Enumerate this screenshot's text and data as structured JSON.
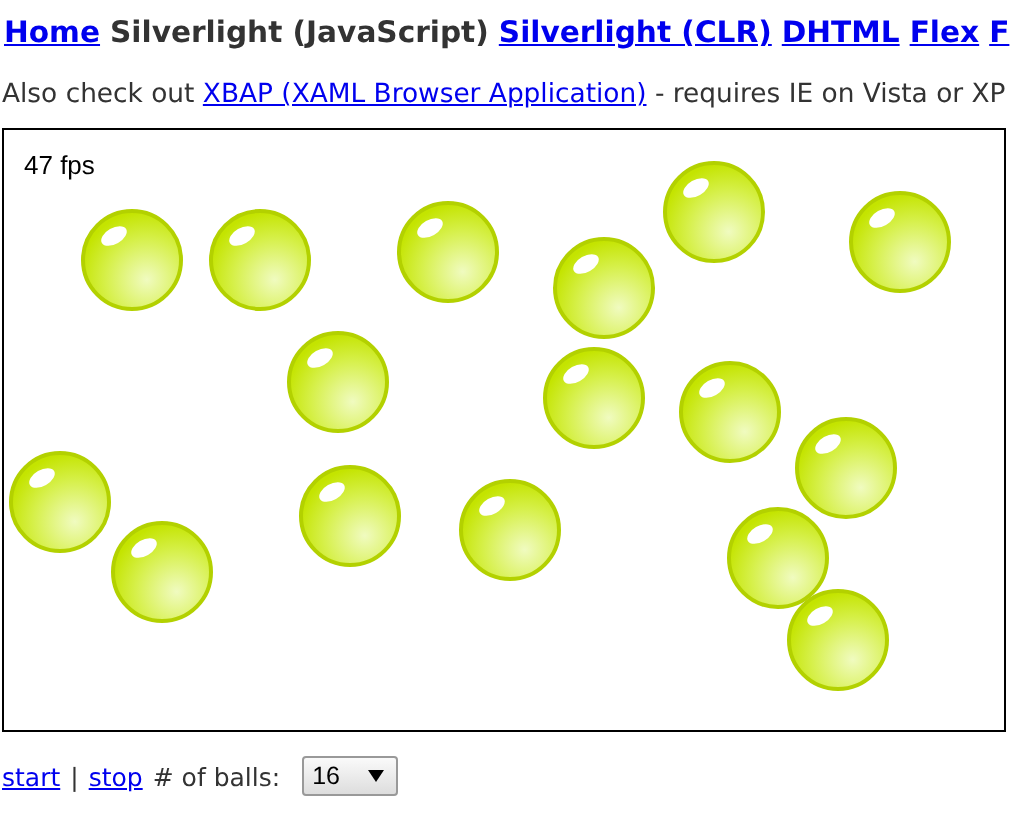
{
  "nav_links": [
    {
      "label": "Home",
      "kind": "link"
    },
    {
      "label": "Silverlight (JavaScript)",
      "kind": "current"
    },
    {
      "label": "Silverlight (CLR)",
      "kind": "link"
    },
    {
      "label": "DHTML",
      "kind": "link"
    },
    {
      "label": "Flex",
      "kind": "link"
    },
    {
      "label": "F",
      "kind": "link"
    }
  ],
  "note": {
    "before": "Also check out ",
    "link": "XBAP (XAML Browser Application)",
    "after": " - requires IE on Vista or XP"
  },
  "canvas": {
    "fps": "47 fps"
  },
  "controls": {
    "start": "start",
    "separator": "|",
    "stop": "stop",
    "balls_label": "# of balls:",
    "balls_value": "16"
  }
}
